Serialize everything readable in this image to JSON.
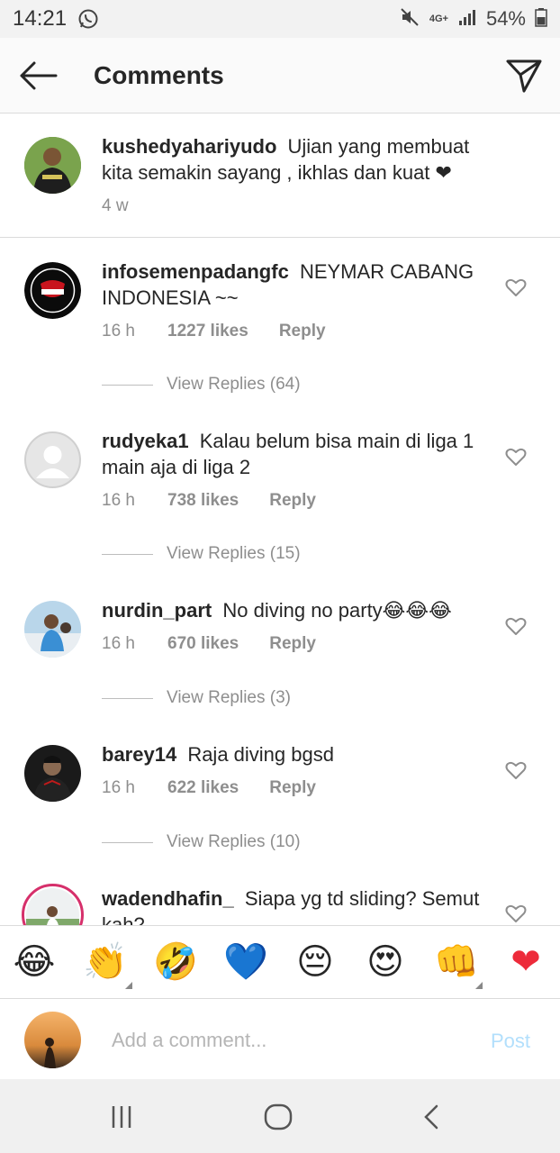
{
  "status": {
    "time": "14:21",
    "network": "4G+",
    "battery": "54%",
    "icons": [
      "whatsapp-icon",
      "mute-icon",
      "signal-icon",
      "battery-icon"
    ]
  },
  "header": {
    "title": "Comments",
    "back_icon": "arrow-left-icon",
    "share_icon": "paper-plane-icon"
  },
  "caption": {
    "username": "kushedyahariyudo",
    "text": "Ujian yang membuat kita semakin sayang , ikhlas dan kuat ❤",
    "time": "4 w"
  },
  "comments": [
    {
      "username": "infosemenpadangfc",
      "text": "NEYMAR CABANG INDONESIA ~~",
      "time": "16 h",
      "likes": "1227 likes",
      "reply": "Reply",
      "view_replies": "View Replies (64)"
    },
    {
      "username": "rudyeka1",
      "text": "Kalau belum bisa main di liga 1 main aja di liga 2",
      "time": "16 h",
      "likes": "738 likes",
      "reply": "Reply",
      "view_replies": "View Replies (15)"
    },
    {
      "username": "nurdin_part",
      "text": "No diving no party😂😂😂",
      "time": "16 h",
      "likes": "670 likes",
      "reply": "Reply",
      "view_replies": "View Replies (3)"
    },
    {
      "username": "barey14",
      "text": "Raja diving bgsd",
      "time": "16 h",
      "likes": "622 likes",
      "reply": "Reply",
      "view_replies": "View Replies (10)"
    },
    {
      "username": "wadendhafin_",
      "text": "Siapa yg td sliding? Semut kah?"
    }
  ],
  "emoji_bar": [
    "😂",
    "👏",
    "🤣",
    "💙",
    "😔",
    "😍",
    "👊",
    "❤"
  ],
  "composer": {
    "placeholder": "Add a comment...",
    "post_label": "Post"
  },
  "colors": {
    "text": "#262626",
    "secondary": "#8e8e8e",
    "post_disabled": "#b2dffc",
    "heart": "#ed2b3a"
  }
}
